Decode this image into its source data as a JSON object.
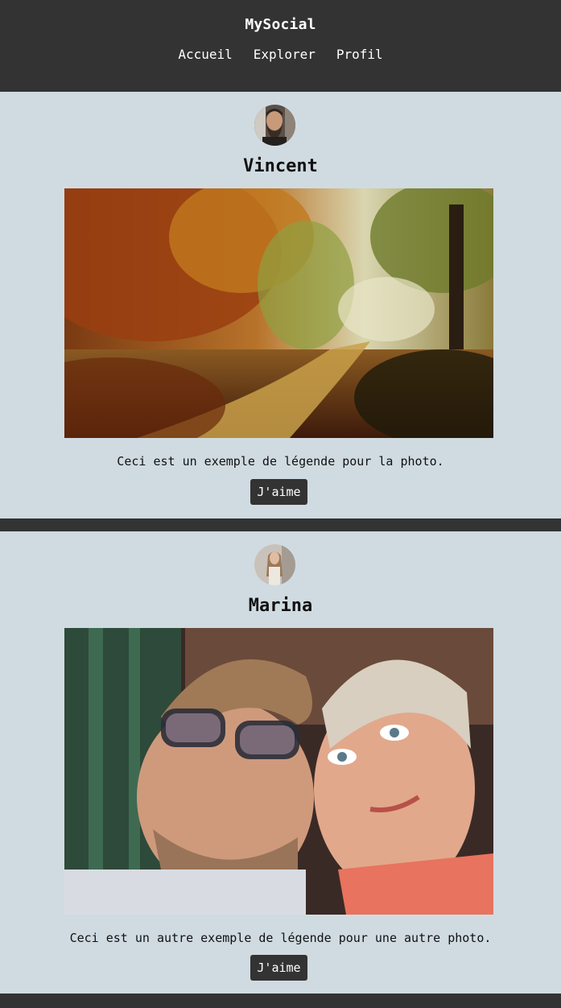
{
  "site": {
    "brand": "MySocial",
    "nav": [
      "Accueil",
      "Explorer",
      "Profil"
    ]
  },
  "posts": [
    {
      "username": "Vincent",
      "caption": "Ceci est un exemple de légende pour la photo.",
      "like_label": "J'aime",
      "photo_subject": "autumn forest path"
    },
    {
      "username": "Marina",
      "caption": "Ceci est un autre exemple de légende pour une autre photo.",
      "like_label": "J'aime",
      "photo_subject": "couple selfie"
    }
  ],
  "colors": {
    "header_bg": "#333333",
    "post_bg": "#d0dbe1",
    "button_bg": "#333333",
    "text": "#111111"
  }
}
